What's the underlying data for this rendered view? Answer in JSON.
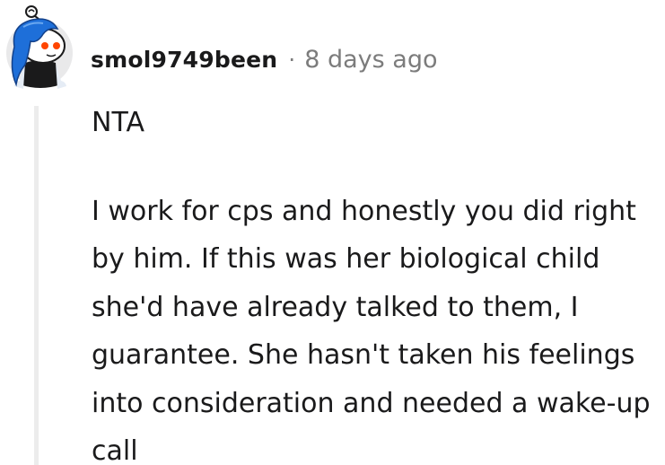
{
  "comment": {
    "username": "smol9749been",
    "separator": "·",
    "timestamp": "8 days ago",
    "paragraphs": [
      "NTA",
      "I work for cps and honestly you did right by him. If this was her biological child she'd have already talked to them, I guarantee. She hasn't taken his feelings into consideration and needed a wake-up call"
    ],
    "avatar": {
      "icon": "reddit-snoo-avatar-icon",
      "hair_color": "#1e6fd9",
      "eye_color": "#ff4500"
    }
  }
}
